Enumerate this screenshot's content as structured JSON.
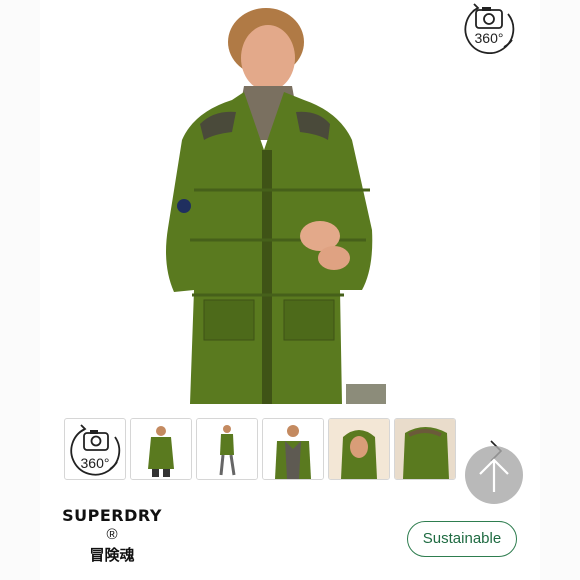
{
  "view360": {
    "label": "360°",
    "icon": "camera-360-icon"
  },
  "thumbnails": [
    {
      "kind": "360",
      "label": "360°"
    },
    {
      "kind": "image",
      "view": "front-full"
    },
    {
      "kind": "image",
      "view": "side-full"
    },
    {
      "kind": "image",
      "view": "front-mid"
    },
    {
      "kind": "image",
      "view": "hood-up"
    },
    {
      "kind": "image",
      "view": "back-detail"
    }
  ],
  "brand": {
    "name": "SUPERDRY",
    "reg": "®",
    "tagline": "冒険魂"
  },
  "badge": {
    "label": "Sustainable"
  },
  "colors": {
    "jacket": "#5a7a1f",
    "accent": "#1f6b42",
    "scroll_button": "#aaaaaa"
  }
}
